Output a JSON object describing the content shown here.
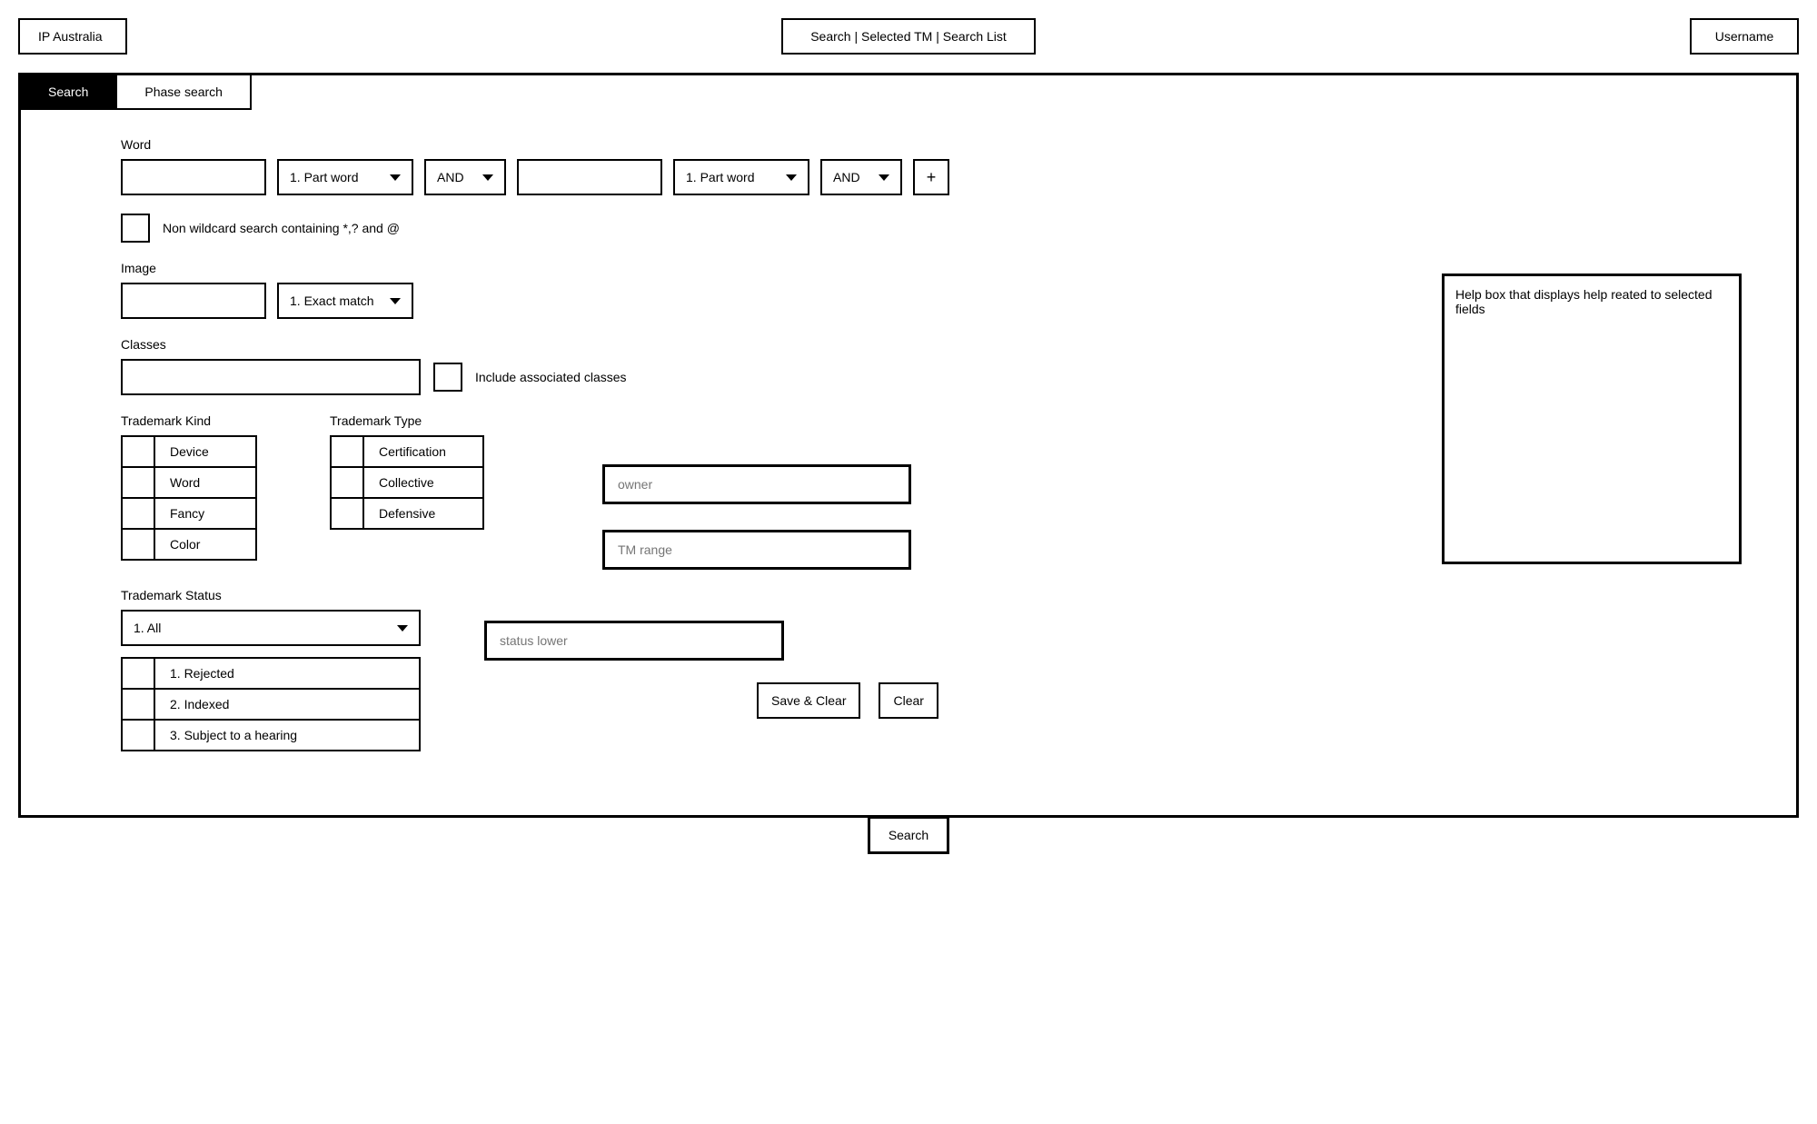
{
  "header": {
    "logo": "IP Australia",
    "breadcrumb": "Search | Selected TM | Search List",
    "username": "Username"
  },
  "tabs": {
    "search": "Search",
    "phase": "Phase search"
  },
  "word": {
    "label": "Word",
    "matchType": "1. Part word",
    "operator": "AND",
    "plus": "+",
    "nonWildcardLabel": "Non wildcard search containing *,? and @"
  },
  "image": {
    "label": "Image",
    "matchType": "1. Exact match"
  },
  "classes": {
    "label": "Classes",
    "includeAssociated": "Include associated classes"
  },
  "trademarkKind": {
    "label": "Trademark Kind",
    "options": [
      "Device",
      "Word",
      "Fancy",
      "Color"
    ]
  },
  "trademarkType": {
    "label": "Trademark Type",
    "options": [
      "Certification",
      "Collective",
      "Defensive"
    ]
  },
  "trademarkStatus": {
    "label": "Trademark Status",
    "selected": "1. All",
    "options": [
      "1. Rejected",
      "2. Indexed",
      "3. Subject to a hearing"
    ]
  },
  "placeholders": {
    "owner": "owner",
    "tmRange": "TM range",
    "statusLower": "status lower"
  },
  "buttons": {
    "saveClear": "Save & Clear",
    "clear": "Clear",
    "search": "Search"
  },
  "help": {
    "text": "Help box that displays help reated to selected fields"
  }
}
